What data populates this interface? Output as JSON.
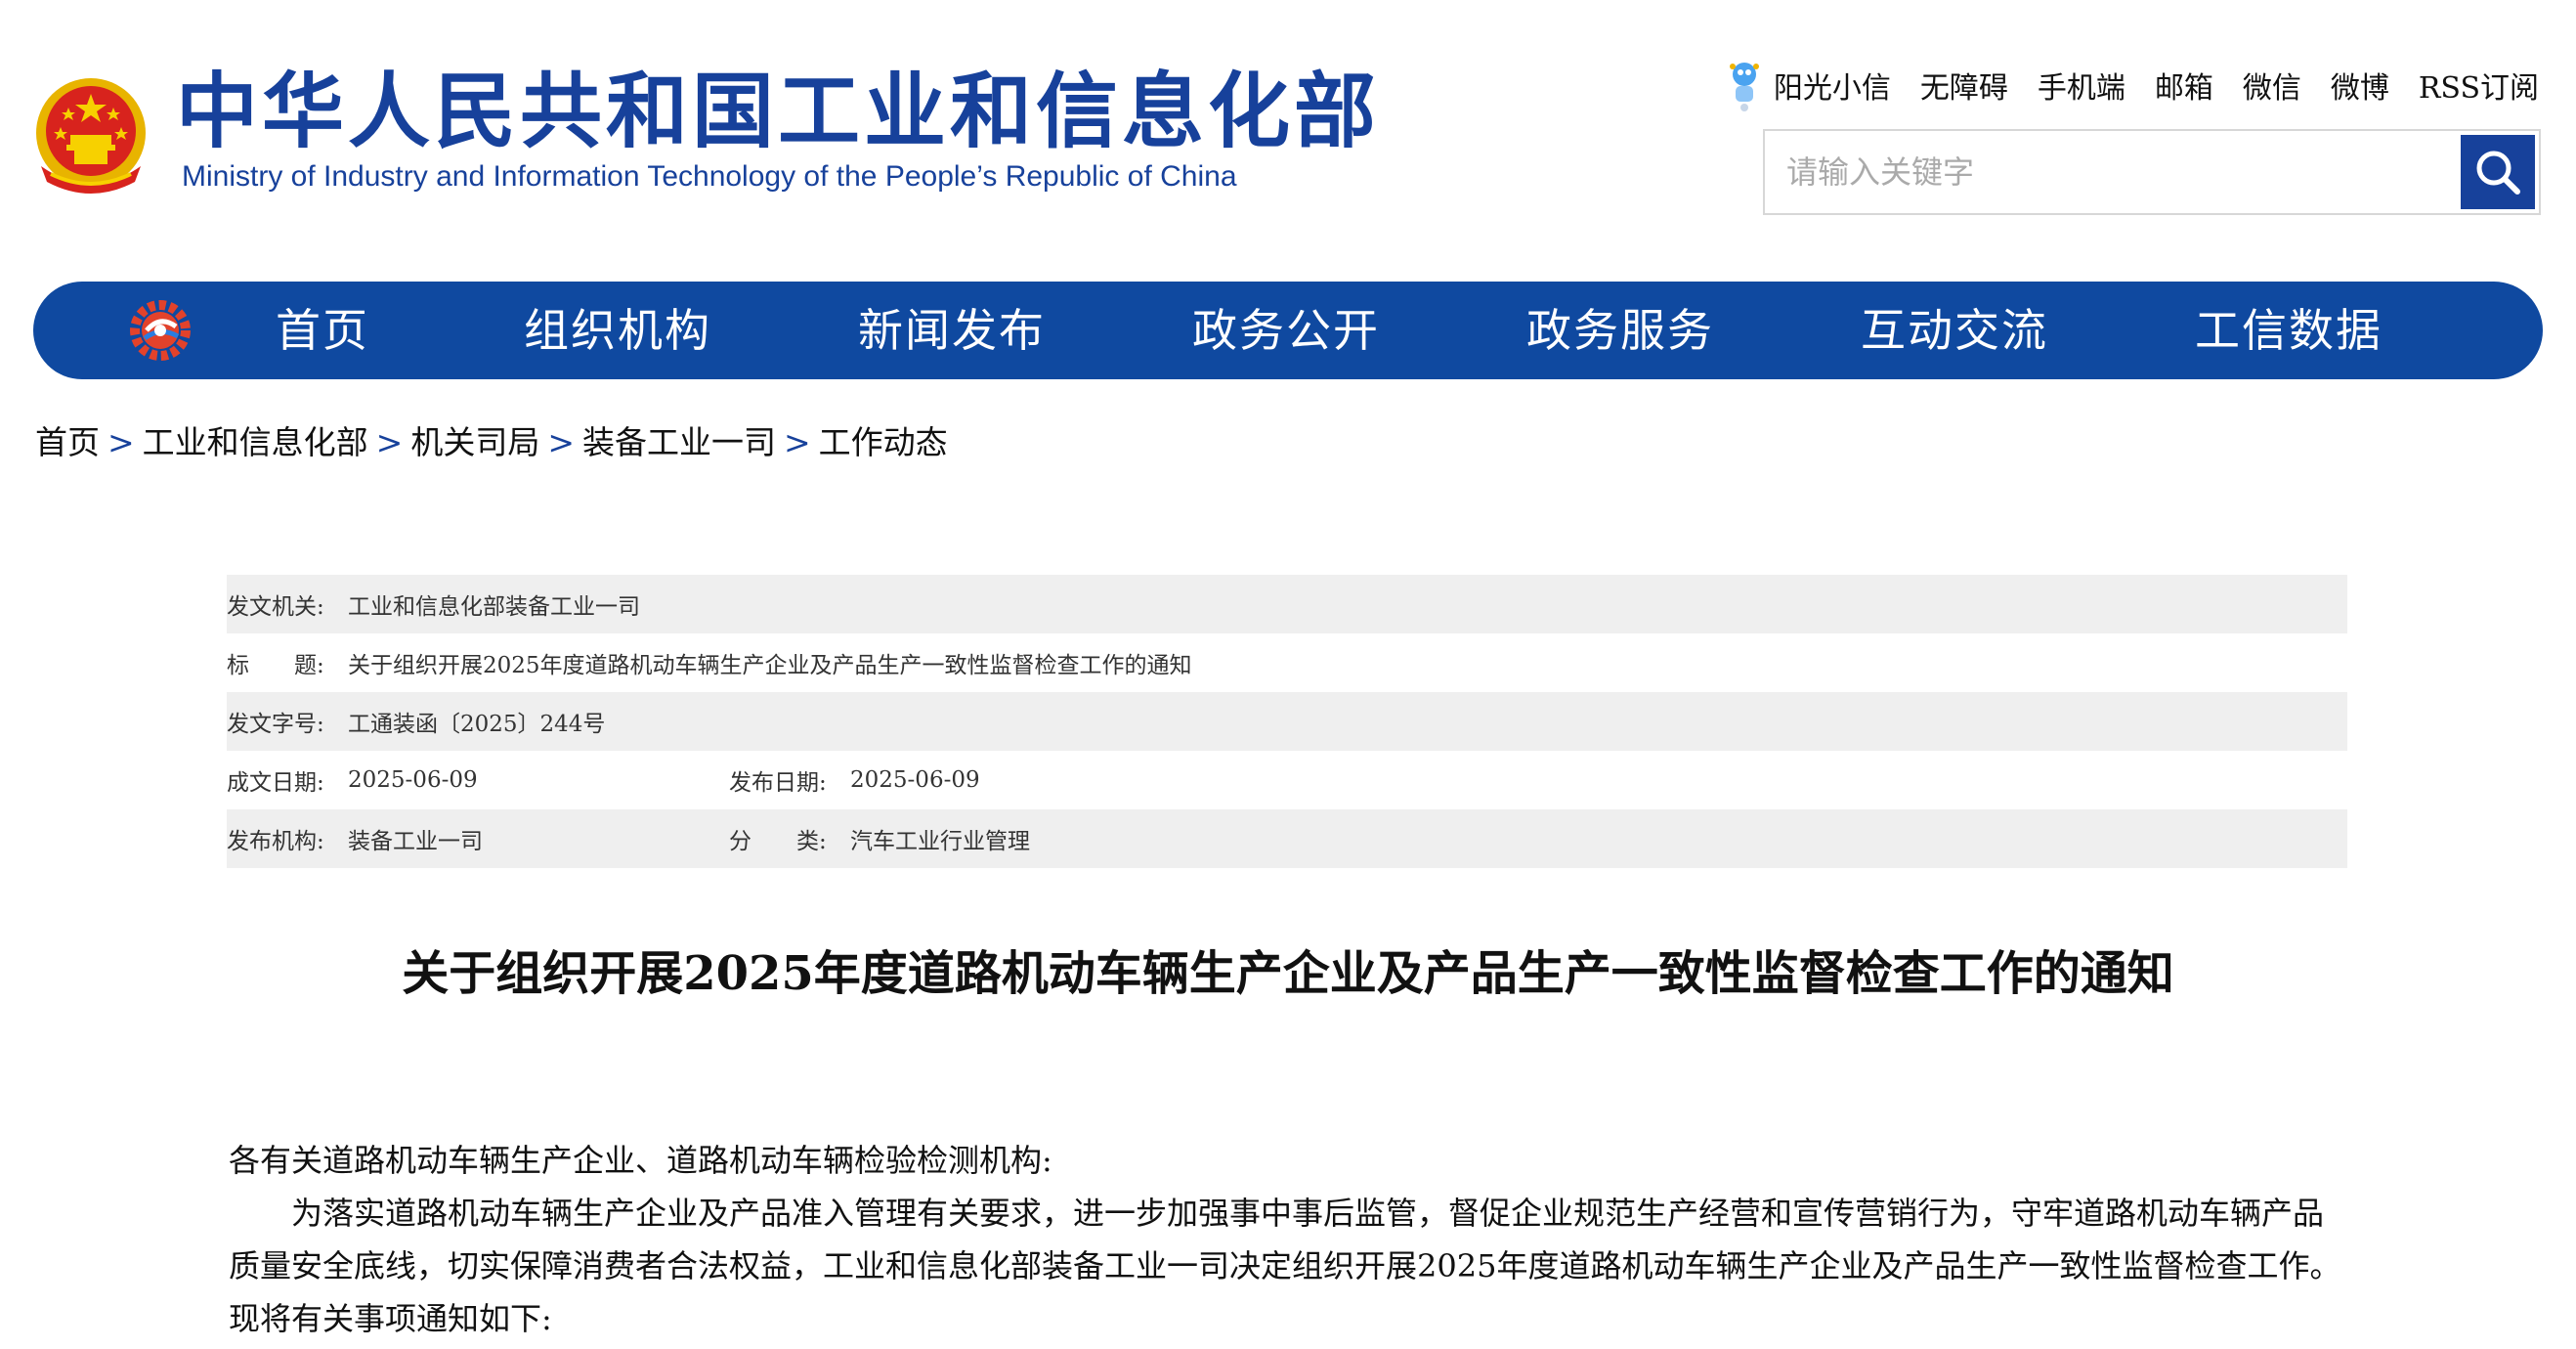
{
  "header": {
    "title_cn": "中华人民共和国工业和信息化部",
    "title_en": "Ministry of Industry and Information Technology of the People’s Republic of China",
    "emblem_icon": "national-emblem-icon",
    "toplinks": [
      "阳光小信",
      "无障碍",
      "手机端",
      "邮箱",
      "微信",
      "微博",
      "RSS订阅"
    ],
    "search": {
      "placeholder": "请输入关键字",
      "value": ""
    }
  },
  "nav": {
    "logo_icon": "miit-gear-logo-icon",
    "items": [
      "首页",
      "组织机构",
      "新闻发布",
      "政务公开",
      "政务服务",
      "互动交流",
      "工信数据"
    ]
  },
  "breadcrumb": {
    "items": [
      "首页",
      "工业和信息化部",
      "机关司局",
      "装备工业一司",
      "工作动态"
    ],
    "separator": ">"
  },
  "meta": {
    "issuer_label": "发文机关:",
    "issuer": "工业和信息化部装备工业一司",
    "title_label": "标　　题:",
    "title": "关于组织开展2025年度道路机动车辆生产企业及产品生产一致性监督检查工作的通知",
    "docno_label": "发文字号:",
    "docno": "工通装函〔2025〕244号",
    "written_label": "成文日期:",
    "written": "2025-06-09",
    "published_label": "发布日期:",
    "published": "2025-06-09",
    "org_label": "发布机构:",
    "org": "装备工业一司",
    "category_label": "分　　类:",
    "category": "汽车工业行业管理"
  },
  "article": {
    "title": "关于组织开展2025年度道路机动车辆生产企业及产品生产一致性监督检查工作的通知",
    "salutation": "各有关道路机动车辆生产企业、道路机动车辆检验检测机构:",
    "paragraph1": "为落实道路机动车辆生产企业及产品准入管理有关要求，进一步加强事中事后监管，督促企业规范生产经营和宣传营销行为，守牢道路机动车辆产品质量安全底线，切实保障消费者合法权益，工业和信息化部装备工业一司决定组织开展2025年度道路机动车辆生产企业及产品生产一致性监督检查工作。现将有关事项通知如下:"
  },
  "colors": {
    "brand_blue": "#17419b",
    "nav_blue": "#0f49a0",
    "meta_shade": "#efefef"
  }
}
